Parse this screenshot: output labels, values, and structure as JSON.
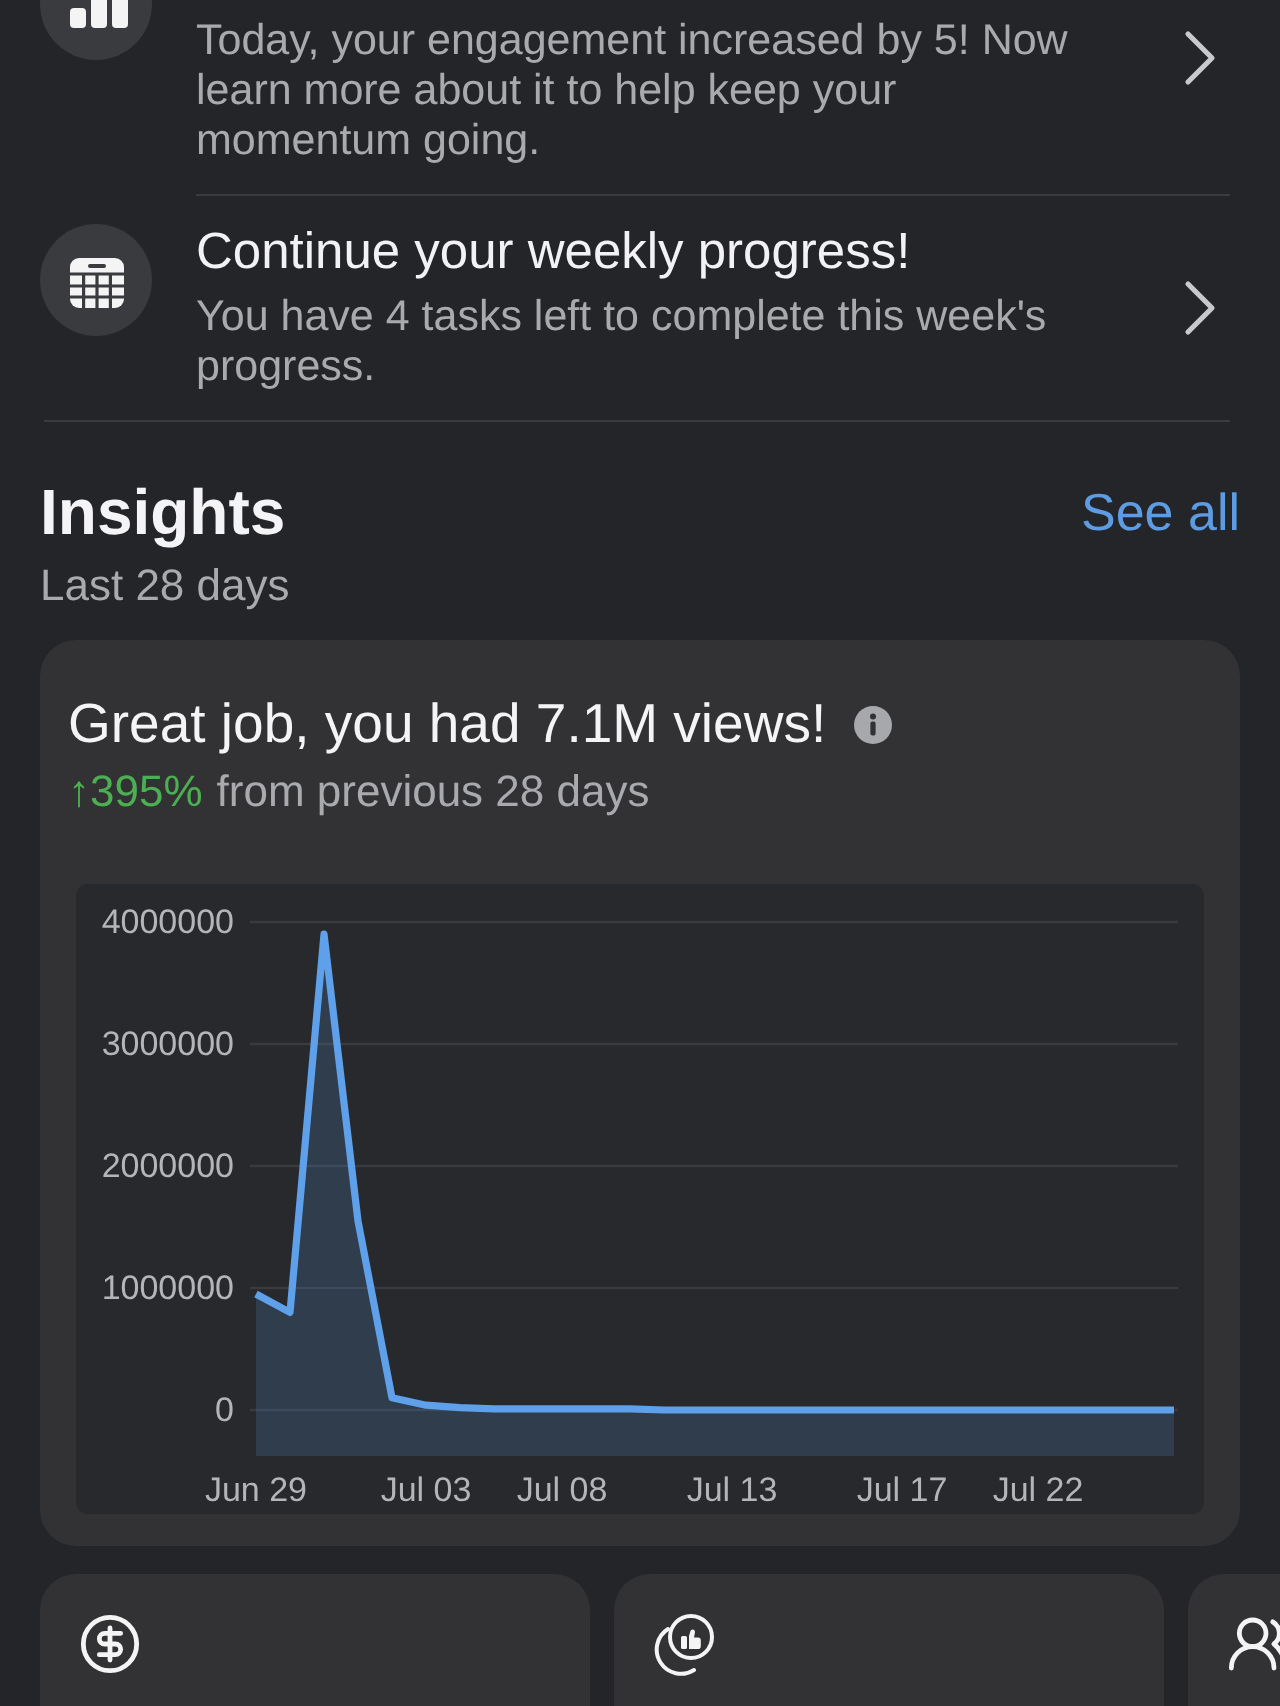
{
  "updates": [
    {
      "kind": "engagement",
      "description": "Today, your engagement increased by 5! Now learn more about it to help keep your momentum going."
    },
    {
      "kind": "calendar",
      "title": "Continue your weekly progress!",
      "description": "You have 4 tasks left to complete this week's progress."
    }
  ],
  "insights": {
    "title": "Insights",
    "link": "See all",
    "period": "Last 28 days",
    "card": {
      "headline": "Great job, you had 7.1M views!",
      "change": "↑395%",
      "change_note": "from previous 28 days",
      "chart_data": {
        "type": "area",
        "categories": [
          "Jun 29",
          null,
          null,
          null,
          null,
          "Jul 03",
          null,
          null,
          null,
          "Jul 08",
          null,
          null,
          null,
          null,
          "Jul 13",
          null,
          null,
          null,
          null,
          "Jul 17",
          null,
          null,
          null,
          "Jul 22",
          null,
          null,
          null,
          null
        ],
        "values": [
          950000,
          800000,
          3900000,
          1550000,
          100000,
          40000,
          20000,
          10000,
          10000,
          10000,
          10000,
          10000,
          0,
          0,
          0,
          0,
          0,
          0,
          0,
          0,
          0,
          0,
          0,
          0,
          0,
          0,
          0,
          0
        ],
        "ylim": [
          0,
          4000000
        ],
        "yticks": [
          0,
          1000000,
          2000000,
          3000000,
          4000000
        ],
        "grid": true
      }
    }
  },
  "tiles": [
    {
      "kind": "earnings"
    },
    {
      "kind": "engagement"
    },
    {
      "kind": "audience"
    }
  ]
}
